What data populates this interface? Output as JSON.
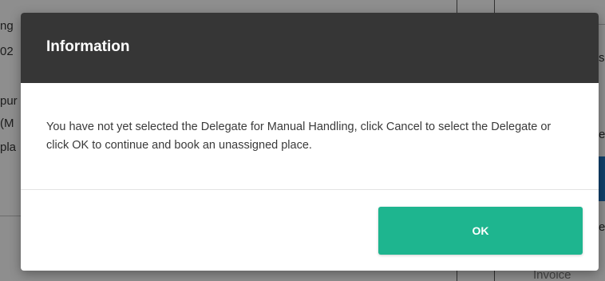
{
  "background": {
    "left_fragments": [
      "ng",
      "02",
      "pur",
      "(M",
      "pla"
    ],
    "right_fragments": [
      "ss",
      "e",
      "e",
      "Invoice"
    ]
  },
  "dialog": {
    "title": "Information",
    "message": "You have not yet selected the Delegate for Manual Handling, click Cancel to select the Delegate or click OK to continue and book an unassigned place.",
    "ok_label": "OK",
    "colors": {
      "header": "#363636",
      "ok_button": "#1eb58f"
    }
  }
}
